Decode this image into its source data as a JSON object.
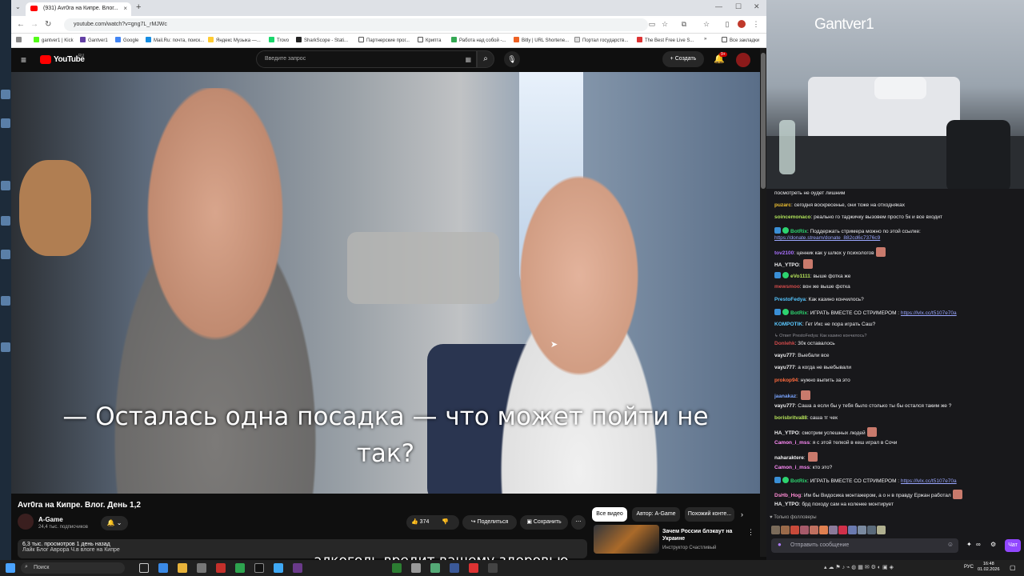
{
  "browser": {
    "tab_title": "(931) Avr0ra на Кипре. Влог...",
    "url": "youtube.com/watch?v=gng7L_rMJWc",
    "bookmarks": [
      "gantver1 | Kick",
      "Gantver1",
      "Google",
      "Mail.Ru: почта, поиск...",
      "Яндекс Музыка —...",
      "Trovo",
      "SharkScope - Stati...",
      "Партнерские прог...",
      "Крипта",
      "Работа над собой -...",
      "Bitly | URL Shortene...",
      "Портал государств...",
      "The Best Free Live S...",
      "Все закладки"
    ]
  },
  "youtube": {
    "logo": "YouTube",
    "region": "RU",
    "search_placeholder": "Введите запрос",
    "create_label": "Создать",
    "notif_count": "9+"
  },
  "video": {
    "subtitle_line1": "— Осталась одна посадка — что может пойти не",
    "subtitle_line2": "так?",
    "title": "Avr0ra на Кипре. Влог. День 1,2",
    "channel": "A-Game",
    "subscribers": "24,4 тыс. подписчиков",
    "likes": "374",
    "share": "Поделиться",
    "save": "Сохранить",
    "views": "6,3 тыс. просмотров  1 день назад",
    "desc": "Лайк Блог Аврора Ч.в влоге на Кипре"
  },
  "chips": [
    "Все видео",
    "Автор: A-Game",
    "Похожий конте..."
  ],
  "rec": {
    "title": "Зачем России блэкаут на Украине",
    "author": "Инструктор Счастливый"
  },
  "stream": {
    "name": "Gantver1"
  },
  "chat": {
    "lines": [
      {
        "text": "посмотреть не оудет лишним",
        "user": "",
        "color": "#efeff1"
      },
      {
        "user": "puzarc",
        "text": "сегодня воскресенье, они тоже на отходняках",
        "color": "#f1c232"
      },
      {
        "user": "soincemonaco",
        "text": "реально го таджичку вызовем просто 5к и все входит",
        "color": "#b0e35a"
      },
      {
        "user": "BotRix",
        "text": "Поддержать стримера можно по этой ссылке:",
        "color": "#2dd36f",
        "badges": true
      },
      {
        "user": "",
        "text": "https://donate.stream/donate_882cd6c7376c9",
        "color": "#efeff1",
        "link": true
      },
      {
        "user": "tov2100",
        "text": "ценник как у шлюх у психологов",
        "color": "#a970ff",
        "emote": true
      },
      {
        "user": "HA_YTPO",
        "text": "",
        "color": "#efeff1",
        "emote": true
      },
      {
        "user": "eVo1111",
        "text": "выше фотка же",
        "color": "#b6e35a",
        "badges": true
      },
      {
        "user": "mewsmoo",
        "text": "вон же выше фотка",
        "color": "#d24b4b"
      },
      {
        "user": "PrestoFedya",
        "text": "Как казино кончилось?",
        "color": "#54c5ff"
      },
      {
        "user": "BotRix",
        "text": "ИГРАТЬ ВМЕСТЕ СО СТРИМЕРОМ : ",
        "link_text": "https://lvlx.cc/t5107e70a",
        "color": "#2dd36f",
        "badges": true
      },
      {
        "user": "KOMPOTIK",
        "text": "Гет Икс не пора играть Саш?",
        "color": "#5ac8ff"
      },
      {
        "user": "",
        "text": "↳ Ответ PrestoFedya: Как казино кончилось?",
        "color": "#8f8f96",
        "small": true
      },
      {
        "user": "Donlehk",
        "text": "30к оставалось",
        "color": "#d24b4b"
      },
      {
        "user": "vayu777",
        "text": "Выебали все",
        "color": "#efeff1"
      },
      {
        "user": "vayu777",
        "text": "а когда не выебывали",
        "color": "#efeff1"
      },
      {
        "user": "prokop94",
        "text": "нужно выпить за это",
        "color": "#ff6a3d"
      },
      {
        "user": "jaanakaz",
        "text": "",
        "color": "#7aa5ff",
        "emote": true
      },
      {
        "user": "vayu777",
        "text": "Саша а если бы у тебя было столько ты бы остался таким же ?",
        "color": "#efeff1"
      },
      {
        "user": "borisbritva88",
        "text": "саша тг чек",
        "color": "#b6e35a"
      },
      {
        "user": "HA_YTPO",
        "text": "смотрим успешных людей",
        "color": "#efeff1",
        "emote": true
      },
      {
        "user": "Camon_i_mss",
        "text": "я с этой телкой в кеш играл в Сочи",
        "color": "#ff8bf8"
      },
      {
        "user": "naharaktere",
        "text": "",
        "color": "#efeff1",
        "emote": true
      },
      {
        "user": "Camon_i_mss",
        "text": "кто это?",
        "color": "#ff8bf8"
      },
      {
        "user": "BotRix",
        "text": "ИГРАТЬ ВМЕСТЕ СО СТРИМЕРОМ : ",
        "link_text": "https://lvlx.cc/t5107e70a",
        "color": "#2dd36f",
        "badges": true
      },
      {
        "user": "DsHb_Hog",
        "text": "Им бы Видосика монтажером, а о н в правду Ержан работал",
        "color": "#ff8bd4",
        "emote": true
      },
      {
        "user": "HA_YTPO",
        "text": "брд походу сам на коленке монтирует",
        "color": "#efeff1"
      }
    ],
    "followers_only": "Только фолловеры",
    "input_placeholder": "Отправить сообщение",
    "send_label": "Чат"
  },
  "taskbar": {
    "search": "Поиск",
    "time": "16:48",
    "date": "01.02.2026",
    "lang": "РУС"
  },
  "overlay_caption": "алкоголь вредит вашему здоровью"
}
